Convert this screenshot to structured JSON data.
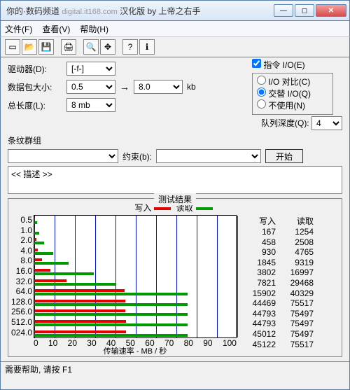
{
  "window": {
    "title_prefix": "你的·数码频道",
    "watermark": "digital.it168.com",
    "title_suffix": "汉化版 by 上帝之右手"
  },
  "menu": {
    "file": "文件(F)",
    "view": "查看(V)",
    "help": "帮助(H)"
  },
  "toolbar_icons": [
    "new",
    "open",
    "save",
    "print",
    "preview",
    "move",
    "help",
    "about"
  ],
  "labels": {
    "drive": "驱动器(D):",
    "block": "数据包大小:",
    "total": "总长度(L):",
    "kb": "kb",
    "arrow": "→",
    "cmd_io": "指令 I/O(E)",
    "opt_compare": "I/O 对比(C)",
    "opt_alt": "交替 I/O(Q)",
    "opt_disable": "不使用(N)",
    "qdepth": "队列深度(Q):",
    "stripe": "条纹群组",
    "constraint": "约束(b):",
    "start": "开始",
    "desc_placeholder": "<< 描述 >>",
    "results_title": "测试结果",
    "legend_write": "写入",
    "legend_read": "读取",
    "col_write": "写入",
    "col_read": "读取",
    "xaxis": "传输速率 - MB / 秒",
    "status": "需要帮助, 请按 F1"
  },
  "values": {
    "drive": "[-f-]",
    "block_from": "0.5",
    "block_to": "8.0",
    "total": "8 mb",
    "cmd_io_checked": true,
    "radio_selected": 1,
    "qdepth": "4"
  },
  "chart_data": {
    "type": "bar",
    "xlim": [
      0,
      100
    ],
    "xticks": [
      0,
      10,
      20,
      30,
      40,
      50,
      60,
      70,
      80,
      90,
      100
    ],
    "xlabel": "传输速率 - MB / 秒",
    "categories": [
      "0.5",
      "1.0",
      "2.0",
      "4.0",
      "8.0",
      "16.0",
      "32.0",
      "64.0",
      "128.0",
      "256.0",
      "512.0",
      "024.0"
    ],
    "series": [
      {
        "name": "写入",
        "color": "#e30000",
        "values": [
          167,
          458,
          930,
          1845,
          3802,
          7821,
          15902,
          44469,
          44793,
          44793,
          45012,
          45122
        ]
      },
      {
        "name": "读取",
        "color": "#009a00",
        "values": [
          1254,
          2508,
          4765,
          9319,
          16997,
          29468,
          40329,
          75517,
          75497,
          75497,
          75497,
          75517
        ]
      }
    ],
    "display_scale": 1000
  }
}
